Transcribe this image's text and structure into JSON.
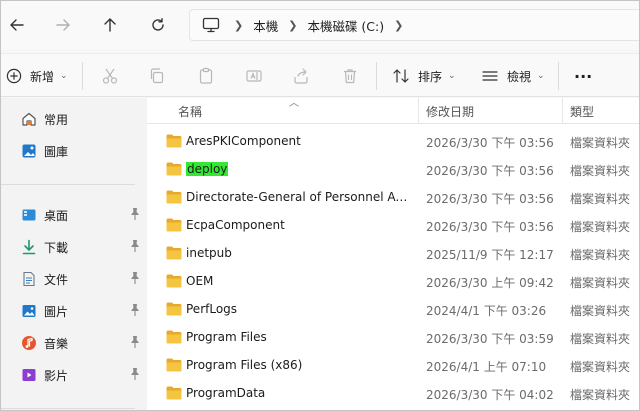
{
  "navigation": {
    "breadcrumb": [
      {
        "label": "本機"
      },
      {
        "label": "本機磁碟 (C:)"
      }
    ]
  },
  "toolbar": {
    "new_label": "新增",
    "sort_label": "排序",
    "view_label": "檢視",
    "more_label": "···"
  },
  "sidebar": {
    "top_items": [
      {
        "label": "常用",
        "icon": "home-icon"
      },
      {
        "label": "圖庫",
        "icon": "gallery-icon"
      }
    ],
    "pinned_items": [
      {
        "label": "桌面",
        "icon": "desktop-icon"
      },
      {
        "label": "下載",
        "icon": "download-icon"
      },
      {
        "label": "文件",
        "icon": "documents-icon"
      },
      {
        "label": "圖片",
        "icon": "pictures-icon"
      },
      {
        "label": "音樂",
        "icon": "music-icon"
      },
      {
        "label": "影片",
        "icon": "videos-icon"
      }
    ]
  },
  "columns": {
    "name": "名稱",
    "date": "修改日期",
    "type": "類型"
  },
  "files": [
    {
      "name": "AresPKIComponent",
      "date": "2026/3/30 下午 03:56",
      "type": "檔案資料夾"
    },
    {
      "name": "deploy",
      "date": "2026/3/30 下午 03:56",
      "type": "檔案資料夾",
      "highlighted": true
    },
    {
      "name": "Directorate-General of Personnel Adm...",
      "date": "2026/3/30 下午 03:56",
      "type": "檔案資料夾"
    },
    {
      "name": "EcpaComponent",
      "date": "2026/3/30 下午 03:56",
      "type": "檔案資料夾"
    },
    {
      "name": "inetpub",
      "date": "2025/11/9 下午 12:17",
      "type": "檔案資料夾"
    },
    {
      "name": "OEM",
      "date": "2026/3/30 上午 09:42",
      "type": "檔案資料夾"
    },
    {
      "name": "PerfLogs",
      "date": "2024/4/1 下午 03:26",
      "type": "檔案資料夾"
    },
    {
      "name": "Program Files",
      "date": "2026/3/30 下午 03:59",
      "type": "檔案資料夾"
    },
    {
      "name": "Program Files (x86)",
      "date": "2026/4/1 上午 07:10",
      "type": "檔案資料夾"
    },
    {
      "name": "ProgramData",
      "date": "2026/3/30 下午 04:02",
      "type": "檔案資料夾"
    }
  ],
  "colors": {
    "highlight": "#33e833",
    "folder": "#f5c542",
    "accent": "#0067c0"
  }
}
